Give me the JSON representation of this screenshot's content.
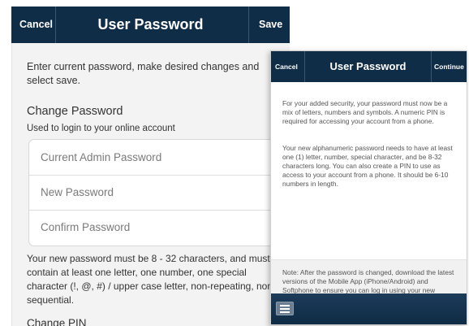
{
  "screen_a": {
    "nav": {
      "cancel_label": "Cancel",
      "title": "User Password",
      "save_label": "Save"
    },
    "intro": "Enter current password, make desired changes and select save.",
    "section_title": "Change Password",
    "section_subtitle": "Used to login to your online account",
    "fields": {
      "current_placeholder": "Current Admin Password",
      "new_placeholder": "New Password",
      "confirm_placeholder": "Confirm Password"
    },
    "rules": "Your new password must be 8 - 32 characters, and must contain at least one letter, one number, one special character (!, @, #) / upper case letter, non-repeating, non-sequential.",
    "pin_title": "Change PIN"
  },
  "screen_b": {
    "nav": {
      "cancel_label": "Cancel",
      "title": "User Password",
      "continue_label": "Continue"
    },
    "para1": "For your added security, your password must now be a mix of letters, numbers and symbols. A numeric PIN is required for accessing your account from a phone.",
    "para2": "Your new alphanumeric password needs to have at least one (1) letter, number, special character, and be 8-32 characters long. You can also create a PIN to use as access to your account from a phone. It should be 6-10 numbers in length.",
    "note": "Note: After the password is changed, download the latest versions of the Mobile App (iPhone/Android) and Softphone to ensure you can log in using your new password.",
    "toolbar": {
      "menu_icon": "menu-icon"
    }
  },
  "colors": {
    "nav_bar": "#102d47",
    "body_bg": "#f3f3f4",
    "text": "#333333"
  }
}
